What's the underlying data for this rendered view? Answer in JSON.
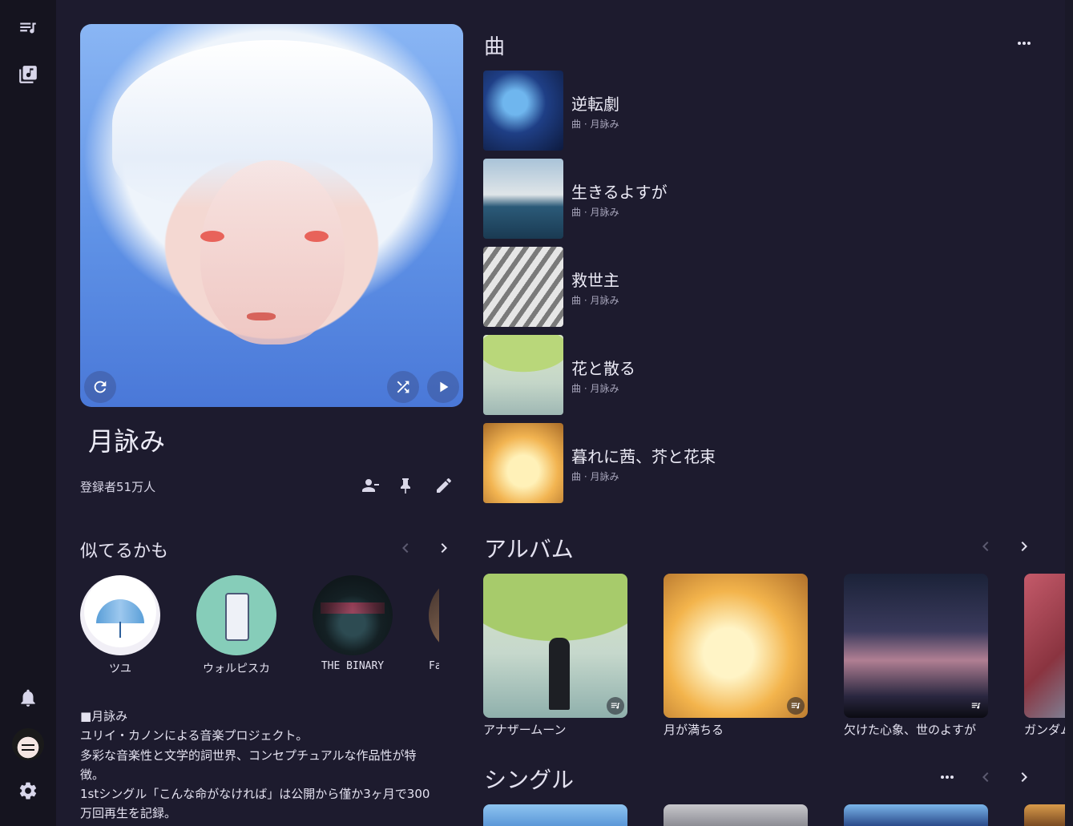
{
  "sidebar": {
    "icons": [
      "queue-music-icon",
      "library-music-icon",
      "bell-icon",
      "settings-icon"
    ]
  },
  "artist": {
    "name": "月詠み",
    "subscribers": "登録者51万人"
  },
  "similar": {
    "title": "似てるかも",
    "items": [
      {
        "name": "ツユ"
      },
      {
        "name": "ウォルピスカ"
      },
      {
        "name": "THE BINARY"
      },
      {
        "name": "Fanta"
      }
    ]
  },
  "description": {
    "lines": [
      "■月詠み",
      "ユリイ・カノンによる音楽プロジェクト。",
      "多彩な音楽性と文学的詞世界、コンセプチュアルな作品性が特",
      "徴。",
      "1stシングル「こんな命がなければ」は公開から僅か3ヶ月で300",
      "万回再生を記録。"
    ]
  },
  "songs": {
    "title": "曲",
    "items": [
      {
        "title": "逆転劇",
        "sub": "曲 · 月詠み"
      },
      {
        "title": "生きるよすが",
        "sub": "曲 · 月詠み"
      },
      {
        "title": "救世主",
        "sub": "曲 · 月詠み"
      },
      {
        "title": "花と散る",
        "sub": "曲 · 月詠み"
      },
      {
        "title": "暮れに茜、芥と花束",
        "sub": "曲 · 月詠み"
      }
    ]
  },
  "albums": {
    "title": "アルバム",
    "items": [
      {
        "title": "アナザームーン"
      },
      {
        "title": "月が満ちる"
      },
      {
        "title": "欠けた心象、世のよすが"
      },
      {
        "title": "ガンダム"
      }
    ]
  },
  "singles": {
    "title": "シングル"
  },
  "colors": {
    "background": "#1d1b2e",
    "rail": "#15141f",
    "text": "#e4e2f0",
    "muted": "#a9a7bd"
  }
}
